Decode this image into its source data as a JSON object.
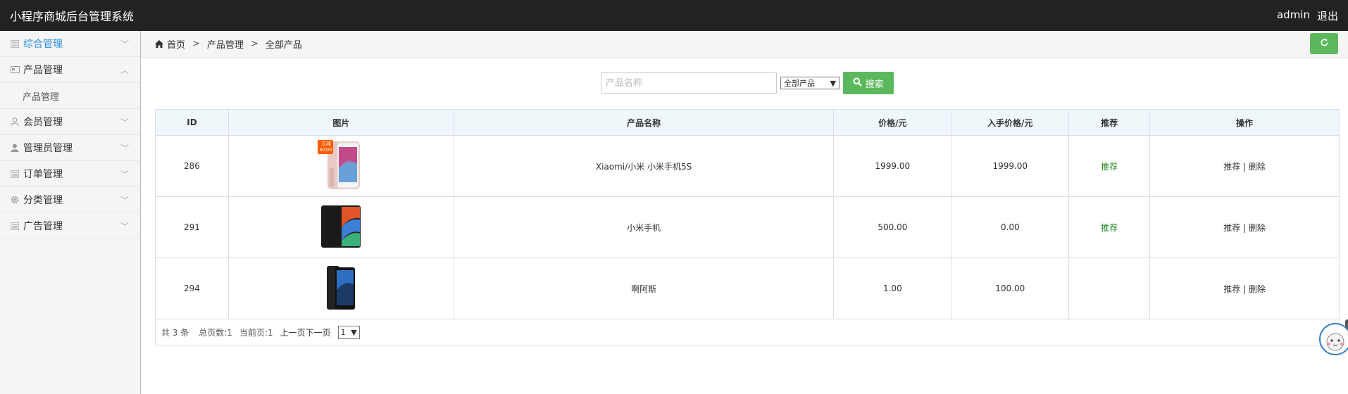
{
  "header": {
    "title": "小程序商城后台管理系统",
    "user": "admin",
    "logout": "退出"
  },
  "sidebar": {
    "items": [
      {
        "label": "综合管理",
        "icon": "list-icon",
        "active": true,
        "expanded": false
      },
      {
        "label": "产品管理",
        "icon": "card-icon",
        "active": false,
        "expanded": true,
        "children": [
          {
            "label": "产品管理"
          }
        ]
      },
      {
        "label": "会员管理",
        "icon": "user-outline-icon",
        "active": false,
        "expanded": false
      },
      {
        "label": "管理员管理",
        "icon": "user-icon",
        "active": false,
        "expanded": false
      },
      {
        "label": "订单管理",
        "icon": "list-icon",
        "active": false,
        "expanded": false
      },
      {
        "label": "分类管理",
        "icon": "gear-icon",
        "active": false,
        "expanded": false
      },
      {
        "label": "广告管理",
        "icon": "list-icon",
        "active": false,
        "expanded": false
      }
    ]
  },
  "breadcrumb": {
    "home": "首页",
    "level1": "产品管理",
    "level2": "全部产品",
    "sep": ">"
  },
  "search": {
    "placeholder": "产品名称",
    "select_value": "全部产品",
    "button": "搜索"
  },
  "table": {
    "headers": {
      "id": "ID",
      "image": "图片",
      "name": "产品名称",
      "price": "价格/元",
      "in_price": "入手价格/元",
      "recommend": "推荐",
      "ops": "操作"
    },
    "rows": [
      {
        "id": "286",
        "name": "Xiaomi/小米 小米手机5S",
        "price": "1999.00",
        "in_price": "1999.00",
        "recommend": "推荐",
        "op_recommend": "推荐",
        "op_sep": "|",
        "op_delete": "删除",
        "badge_top": "立减",
        "badge_bottom": "¥200"
      },
      {
        "id": "291",
        "name": "小米手机",
        "price": "500.00",
        "in_price": "0.00",
        "recommend": "推荐",
        "op_recommend": "推荐",
        "op_sep": "|",
        "op_delete": "删除"
      },
      {
        "id": "294",
        "name": "啊阿斯",
        "price": "1.00",
        "in_price": "100.00",
        "recommend": "",
        "op_recommend": "推荐",
        "op_sep": "|",
        "op_delete": "删除"
      }
    ]
  },
  "pager": {
    "total": "共 3 条",
    "pages": "总页数:1",
    "current": "当前页:1",
    "links": "上一页下一页",
    "page_select": "1"
  },
  "colors": {
    "topbar": "#222222",
    "green": "#5cb85c",
    "active_menu": "#2d8fe0",
    "recommend": "#2a8a2a"
  }
}
